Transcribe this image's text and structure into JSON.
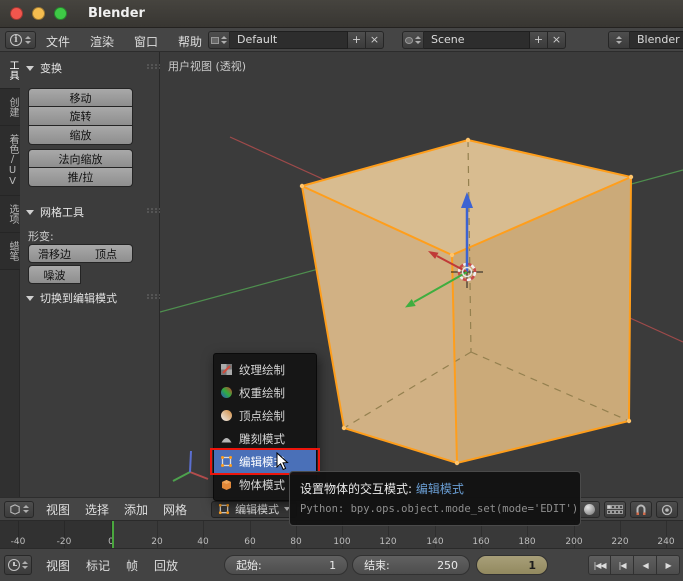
{
  "titlebar": {
    "title": "Blender"
  },
  "infobar": {
    "menus": [
      "文件",
      "渲染",
      "窗口",
      "帮助"
    ],
    "layout": {
      "value": "Default",
      "add_label": "+",
      "remove_label": "×"
    },
    "scene": {
      "value": "Scene",
      "add_label": "+",
      "remove_label": "×"
    },
    "engine": {
      "value": "Blender 渲染"
    }
  },
  "toolshelf": {
    "tabs": [
      "工具",
      "创建",
      "着色/UV",
      "选项",
      "蜡笔"
    ],
    "transform_panel": {
      "title": "变换",
      "buttons": [
        "移动",
        "旋转",
        "缩放",
        "法向缩放",
        "推/拉"
      ]
    },
    "mesh_panel": {
      "title": "网格工具",
      "deform_label": "形变:",
      "row1": [
        "滑移边",
        "顶点"
      ],
      "row2": [
        "噪波"
      ]
    },
    "operator_panel": {
      "title": "切换到编辑模式"
    }
  },
  "viewport": {
    "view_label": "用户视图 (透视)",
    "header": {
      "menus": [
        "视图",
        "选择",
        "添加",
        "网格"
      ],
      "mode_value": "编辑模式"
    },
    "mode_menu": {
      "selected_index": 4,
      "items": [
        {
          "label": "纹理绘制",
          "icon": "texture-paint-icon"
        },
        {
          "label": "权重绘制",
          "icon": "weight-paint-icon"
        },
        {
          "label": "顶点绘制",
          "icon": "vertex-paint-icon"
        },
        {
          "label": "雕刻模式",
          "icon": "sculpt-mode-icon"
        },
        {
          "label": "编辑模式",
          "icon": "edit-mode-icon"
        },
        {
          "label": "物体模式",
          "icon": "object-mode-icon"
        }
      ]
    },
    "tooltip": {
      "label": "设置物体的交互模式: ",
      "value": "编辑模式",
      "python": "Python: bpy.ops.object.mode_set(mode='EDIT')"
    }
  },
  "timeline": {
    "ruler_labels": [
      "-40",
      "-20",
      "0",
      "20",
      "40",
      "60",
      "80",
      "100",
      "120",
      "140",
      "160",
      "180",
      "200",
      "220",
      "240"
    ],
    "menus": [
      "视图",
      "标记",
      "帧",
      "回放"
    ],
    "start_label": "起始:",
    "start_value": "1",
    "end_label": "结束:",
    "end_value": "250",
    "frame_value": "1",
    "playback_buttons": [
      "|◀◀",
      "|◀",
      "◀",
      "▶"
    ]
  },
  "colors": {
    "selection_orange": "#ff9e1b",
    "menu_highlight_blue": "#4a70b8",
    "annotation_red": "#ec150c",
    "tooltip_link_blue": "#6a9ed4",
    "playhead_green": "#4aa73e"
  }
}
